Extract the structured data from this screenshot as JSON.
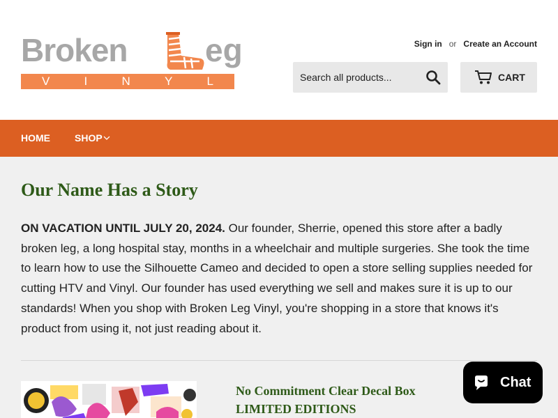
{
  "logo": {
    "word1": "Broken",
    "word2": "eg",
    "tagline": [
      "V",
      "I",
      "N",
      "Y",
      "L"
    ],
    "colors": {
      "text": "#a7a7a7",
      "band": "#f2874d",
      "leg_cast": "#f2874d"
    }
  },
  "header": {
    "account": {
      "sign_in": "Sign in",
      "or": "or",
      "create": "Create an Account"
    },
    "search": {
      "placeholder": "Search all products...",
      "icon": "search-icon"
    },
    "cart": {
      "label": "CART",
      "icon": "cart-icon"
    }
  },
  "nav": {
    "items": [
      {
        "label": "HOME"
      },
      {
        "label": "SHOP",
        "icon": "chevron-down-icon"
      }
    ],
    "color": "#dc5f22"
  },
  "main": {
    "title": "Our Name Has a Story",
    "story_lead": "ON VACATION UNTIL JULY 20, 2024.",
    "story_body": " Our founder, Sherrie, opened this store after a badly broken leg, a long hospital stay, months in a wheelchair and multiple surgeries.  She took the time to learn how to use the Silhouette Cameo and decided to open a store selling supplies needed for cutting HTV and Vinyl.  Our founder has used everything we sell and makes sure it is up to our standards!  When you shop with Broken Leg Vinyl, you're shopping in a store that knows it's product from using it, not just reading about it.",
    "title_color": "#2e5a18"
  },
  "product": {
    "title": "No Commitment Clear Decal Box LIMITED EDITIONS"
  },
  "chat": {
    "label": "Chat",
    "icon": "chat-bubble-icon"
  }
}
